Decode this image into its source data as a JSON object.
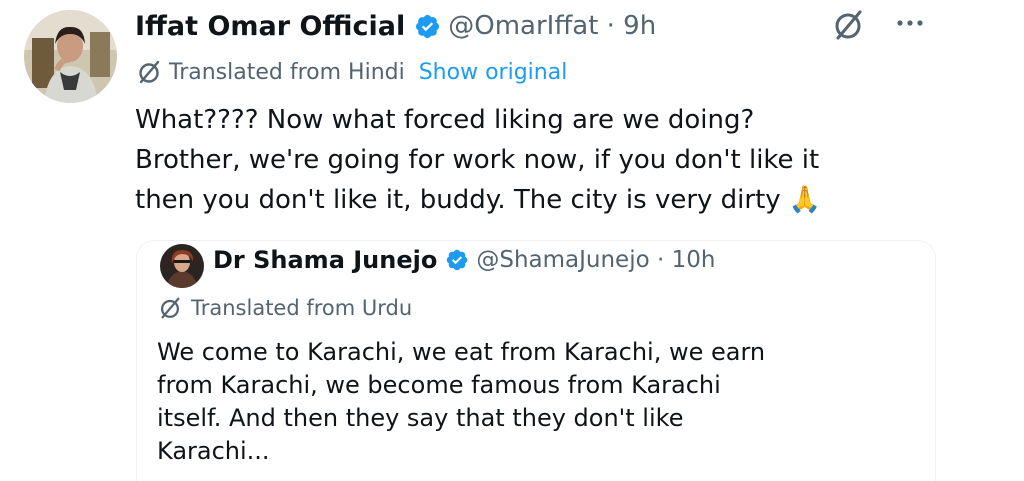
{
  "tweet": {
    "author_name": "Iffat Omar Official",
    "handle_time": "@OmarIffat · 9h",
    "translated_label": "Translated from Hindi",
    "show_original": "Show original",
    "text_lines": [
      "What???? Now what forced liking are we doing?",
      "Brother, we're going for work now, if you don't like it",
      "then you don't like it, buddy. The city is very dirty 🙏"
    ]
  },
  "quote": {
    "author_name": "Dr Shama Junejo",
    "handle_time": "@ShamaJunejo · 10h",
    "translated_label": "Translated from Urdu",
    "text_lines": [
      "We come to Karachi, we eat from Karachi, we earn",
      "from Karachi, we become famous from Karachi",
      "itself. And then they say that they don't like",
      "Karachi..."
    ]
  },
  "icons": {
    "verified": "verified-badge-icon",
    "grok": "grok-icon",
    "more": "more-icon",
    "translate": "translate-icon"
  },
  "colors": {
    "verified": "#1d9bf0",
    "link": "#1d9bf0",
    "secondary_text": "#536471",
    "primary_text": "#0f1419"
  }
}
